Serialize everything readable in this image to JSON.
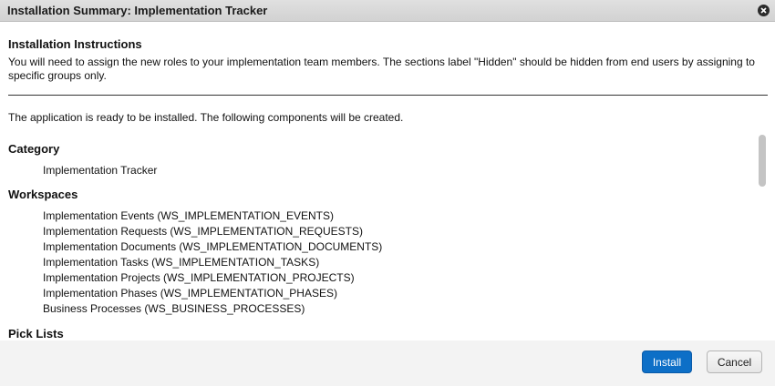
{
  "dialog": {
    "title": "Installation Summary: Implementation Tracker"
  },
  "instructions": {
    "heading": "Installation Instructions",
    "text": "You will need to assign the new roles to your implementation team members. The sections label \"Hidden\" should be hidden from end users by assigning to specific groups only."
  },
  "ready_text": "The application is ready to be installed. The following components will be created.",
  "sections": {
    "category": {
      "title": "Category",
      "items": [
        "Implementation Tracker"
      ]
    },
    "workspaces": {
      "title": "Workspaces",
      "items": [
        "Implementation Events (WS_IMPLEMENTATION_EVENTS)",
        "Implementation Requests (WS_IMPLEMENTATION_REQUESTS)",
        "Implementation Documents (WS_IMPLEMENTATION_DOCUMENTS)",
        "Implementation Tasks (WS_IMPLEMENTATION_TASKS)",
        "Implementation Projects (WS_IMPLEMENTATION_PROJECTS)",
        "Implementation Phases (WS_IMPLEMENTATION_PHASES)",
        "Business Processes (WS_BUSINESS_PROCESSES)"
      ]
    },
    "pick_lists": {
      "title": "Pick Lists"
    }
  },
  "buttons": {
    "install": "Install",
    "cancel": "Cancel"
  },
  "colors": {
    "primary_button": "#0d6fc7",
    "title_bar": "#d8d8d8"
  }
}
